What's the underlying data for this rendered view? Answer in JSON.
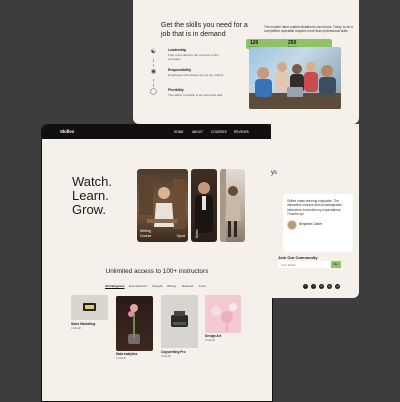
{
  "back_page": {
    "headline": "Get the skills you need for a job that is in demand",
    "features": [
      {
        "title": "Leadership",
        "desc": "Fully committed to the success of the company"
      },
      {
        "title": "Responsibility",
        "desc": "Employees will always be my top priority"
      },
      {
        "title": "Flexibility",
        "desc": "The ability to switch is an important skill"
      }
    ],
    "description": "The modern labor market dictates its own terms. Today, to be a competitive specialist requires more than professional skills",
    "stats": [
      {
        "value": "120",
        "label": "Courses"
      },
      {
        "value": "250",
        "label": "Students"
      }
    ]
  },
  "front_page": {
    "logo": "Skillex",
    "nav": [
      "HOME",
      "ABOUT",
      "COURSES",
      "REVIEWS"
    ],
    "hero": [
      "Watch.",
      "Learn.",
      "Grow."
    ],
    "cards": [
      {
        "label": "Writing Course",
        "label2": "Sport"
      },
      {
        "label": "Music"
      },
      {
        "label": ""
      }
    ],
    "section_title": "Unlimited access to 100+ instructors",
    "categories": [
      "All Categories",
      "Entertainment",
      "Lifestyle",
      "Writing",
      "Business",
      "Food"
    ],
    "tiles": [
      {
        "name": "Sales Marketing",
        "meta": "3 Month"
      },
      {
        "name": "Data analytics",
        "meta": "2 Month"
      },
      {
        "name": "Copywriting Pro",
        "meta": "4 Month"
      },
      {
        "name": "Design Art",
        "meta": "2 Month"
      }
    ]
  },
  "right_page": {
    "partial_heading": "ys",
    "testimonial": "Skillex made learning enjoyable. The interactive courses and knowledgeable instructors exceeded my expectations. Thumbs up!",
    "author": "Benjamin Carter",
    "join_title": "Join Our Community",
    "email_placeholder": "Your Email",
    "go_label": "Go",
    "social": [
      "f",
      "t",
      "in",
      "ig",
      "yt"
    ]
  },
  "colors": {
    "accent": "#8dc266",
    "background": "#f5f0ea",
    "dark": "#101010",
    "backdrop": "#3d3d3d"
  }
}
